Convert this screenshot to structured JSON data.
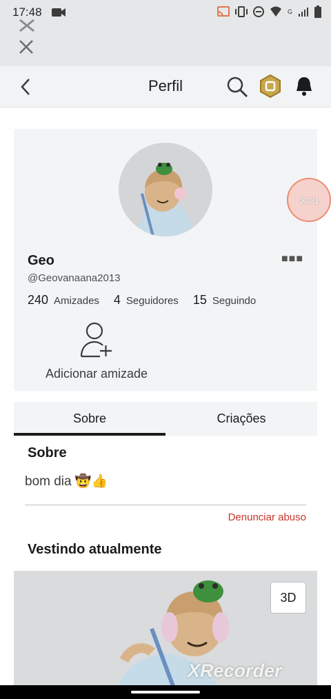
{
  "status_bar": {
    "time": "17:48",
    "network": "G"
  },
  "header": {
    "title": "Perfil"
  },
  "profile": {
    "display_name": "Geo",
    "username": "@Geovanaana2013",
    "friends_count": "240",
    "friends_label": "Amizades",
    "followers_count": "4",
    "followers_label": "Seguidores",
    "following_count": "15",
    "following_label": "Seguindo",
    "add_friend_label": "Adicionar amizade"
  },
  "tabs": [
    {
      "label": "Sobre",
      "active": true
    },
    {
      "label": "Criações",
      "active": false
    }
  ],
  "about": {
    "heading": "Sobre",
    "text": "bom dia 🤠👍",
    "report_label": "Denunciar abuso"
  },
  "wearing": {
    "heading": "Vestindo atualmente",
    "view_3d_label": "3D"
  },
  "recorder": {
    "time": "00:31",
    "watermark": "XRecorder"
  },
  "colors": {
    "report": "#c8352b",
    "tab_indicator": "#191b1d",
    "card_bg": "#f2f4f5"
  }
}
